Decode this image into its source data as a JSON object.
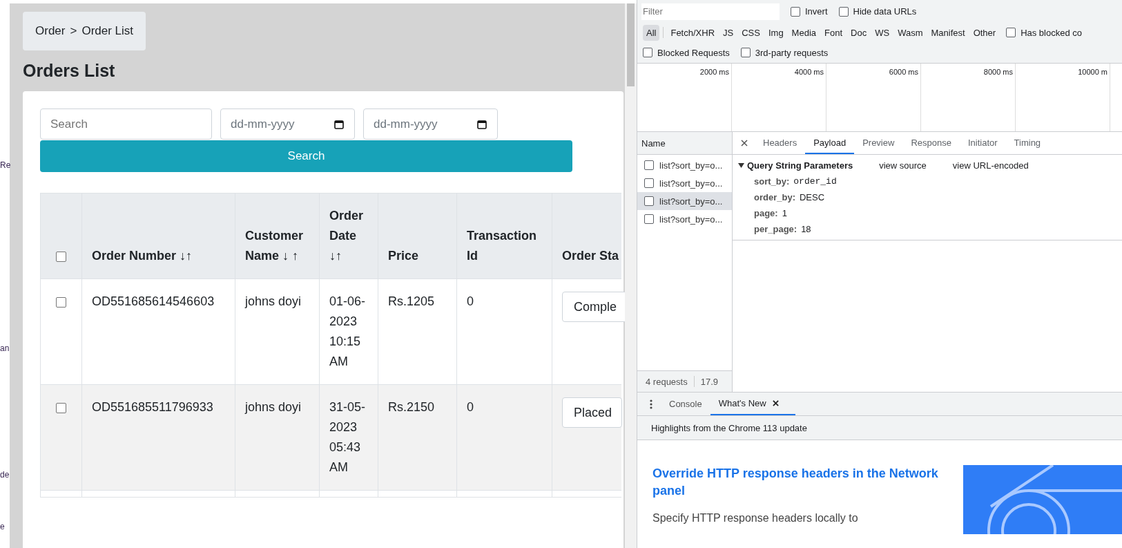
{
  "edge_fragments": [
    "Re",
    "an",
    "de",
    "e"
  ],
  "breadcrumb": {
    "parent": "Order",
    "separator": ">",
    "current": "Order List"
  },
  "page_title": "Orders List",
  "filters": {
    "search_placeholder": "Search",
    "date_from_placeholder": "dd-mm-yyyy",
    "date_to_placeholder": "dd-mm-yyyy",
    "search_button": "Search"
  },
  "table": {
    "select_all_checked": false,
    "columns": [
      {
        "label": "Order Number",
        "sort": "↓↑"
      },
      {
        "label": "Customer Name",
        "sort": "↓ ↑"
      },
      {
        "label": "Order Date",
        "sort": "↓↑"
      },
      {
        "label": "Price"
      },
      {
        "label": "Transaction Id"
      },
      {
        "label": "Order Sta"
      }
    ],
    "rows": [
      {
        "checked": false,
        "order_number": "OD551685614546603",
        "customer": "johns doyi",
        "date": "01-06-2023 10:15 AM",
        "price": "Rs.1205",
        "transaction": "0",
        "status": "Comple"
      },
      {
        "checked": false,
        "order_number": "OD551685511796933",
        "customer": "johns doyi",
        "date": "31-05-2023 05:43 AM",
        "price": "Rs.2150",
        "transaction": "0",
        "status": "Placed"
      }
    ]
  },
  "devtools": {
    "filter_placeholder": "Filter",
    "filter_options": [
      {
        "label": "Invert",
        "checked": false
      },
      {
        "label": "Hide data URLs",
        "checked": false
      }
    ],
    "types": [
      {
        "label": "All",
        "selected": true
      },
      {
        "label": "Fetch/XHR",
        "selected": false
      },
      {
        "label": "JS",
        "selected": false
      },
      {
        "label": "CSS",
        "selected": false
      },
      {
        "label": "Img",
        "selected": false
      },
      {
        "label": "Media",
        "selected": false
      },
      {
        "label": "Font",
        "selected": false
      },
      {
        "label": "Doc",
        "selected": false
      },
      {
        "label": "WS",
        "selected": false
      },
      {
        "label": "Wasm",
        "selected": false
      },
      {
        "label": "Manifest",
        "selected": false
      },
      {
        "label": "Other",
        "selected": false
      }
    ],
    "has_blocked": {
      "label": "Has blocked co",
      "checked": false
    },
    "request_options": [
      {
        "label": "Blocked Requests",
        "checked": false
      },
      {
        "label": "3rd-party requests",
        "checked": false
      }
    ],
    "timeline_ticks": [
      "2000 ms",
      "4000 ms",
      "6000 ms",
      "8000 ms",
      "10000 m"
    ],
    "name_header": "Name",
    "requests": [
      {
        "name": "list?sort_by=o...",
        "selected": false
      },
      {
        "name": "list?sort_by=o...",
        "selected": false
      },
      {
        "name": "list?sort_by=o...",
        "selected": true
      },
      {
        "name": "list?sort_by=o...",
        "selected": false
      }
    ],
    "detail_tabs": [
      {
        "label": "Headers",
        "selected": false
      },
      {
        "label": "Payload",
        "selected": true
      },
      {
        "label": "Preview",
        "selected": false
      },
      {
        "label": "Response",
        "selected": false
      },
      {
        "label": "Initiator",
        "selected": false
      },
      {
        "label": "Timing",
        "selected": false
      }
    ],
    "payload": {
      "section": "Query String Parameters",
      "expanded": true,
      "links": [
        "view source",
        "view URL-encoded"
      ],
      "params": [
        {
          "key": "sort_by:",
          "value": "order_id",
          "mono": true
        },
        {
          "key": "order_by:",
          "value": "DESC",
          "mono": false
        },
        {
          "key": "page:",
          "value": "1",
          "mono": false
        },
        {
          "key": "per_page:",
          "value": "18",
          "mono": false
        }
      ]
    },
    "summary": {
      "requests": "4 requests",
      "size": "17.9"
    },
    "drawer_tabs": [
      {
        "label": "Console",
        "selected": false,
        "closable": false
      },
      {
        "label": "What's New",
        "selected": true,
        "closable": true
      }
    ],
    "drawer_heading": "Highlights from the Chrome 113 update",
    "article": {
      "title": "Override HTTP response headers in the Network panel",
      "text": "Specify HTTP response headers locally to"
    }
  }
}
